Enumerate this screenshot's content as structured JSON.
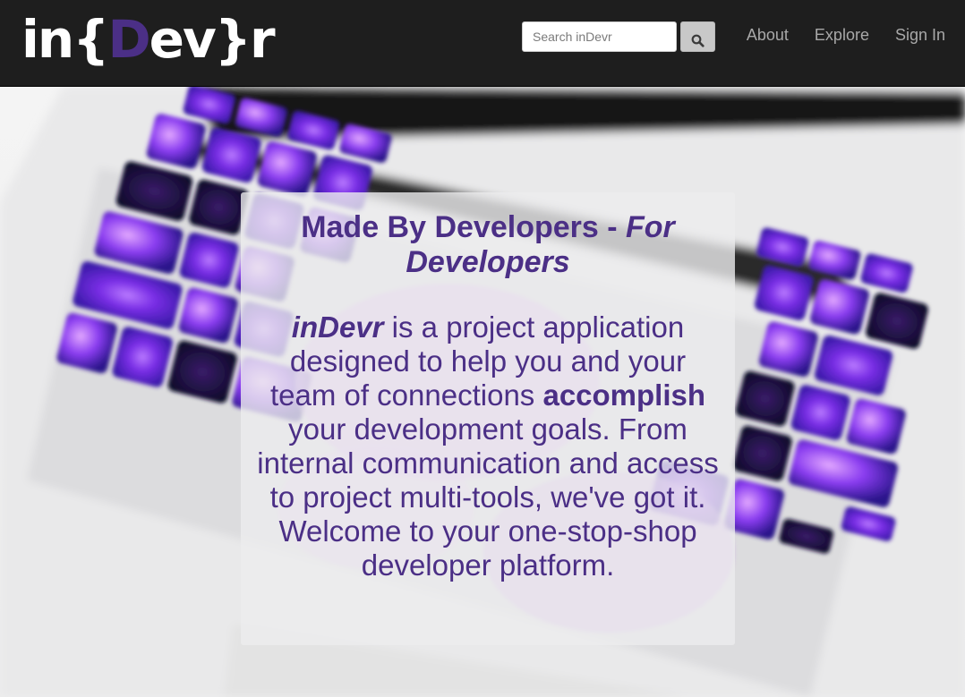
{
  "navbar": {
    "logo": {
      "prefix": "in{",
      "accent": "D",
      "suffix": "ev}r"
    },
    "search": {
      "placeholder": "Search inDevr",
      "button_icon": "search-icon"
    },
    "links": [
      "About",
      "Explore",
      "Sign In"
    ]
  },
  "hero": {
    "title_main": "Made By Developers - ",
    "title_emphasis": "For Developers",
    "body": {
      "brand": "inDevr",
      "text1": " is a project application designed to help you and your team of connections ",
      "strong": "accomplish",
      "text2": " your development goals. From internal communication and access to project multi-tools, we've got it. Welcome to your one-stop-shop developer platform."
    }
  },
  "colors": {
    "navbar_bg": "#1e1e1e",
    "accent_purple": "#4b2f86",
    "nav_link": "#a8a8a8",
    "card_bg": "#ececee"
  }
}
